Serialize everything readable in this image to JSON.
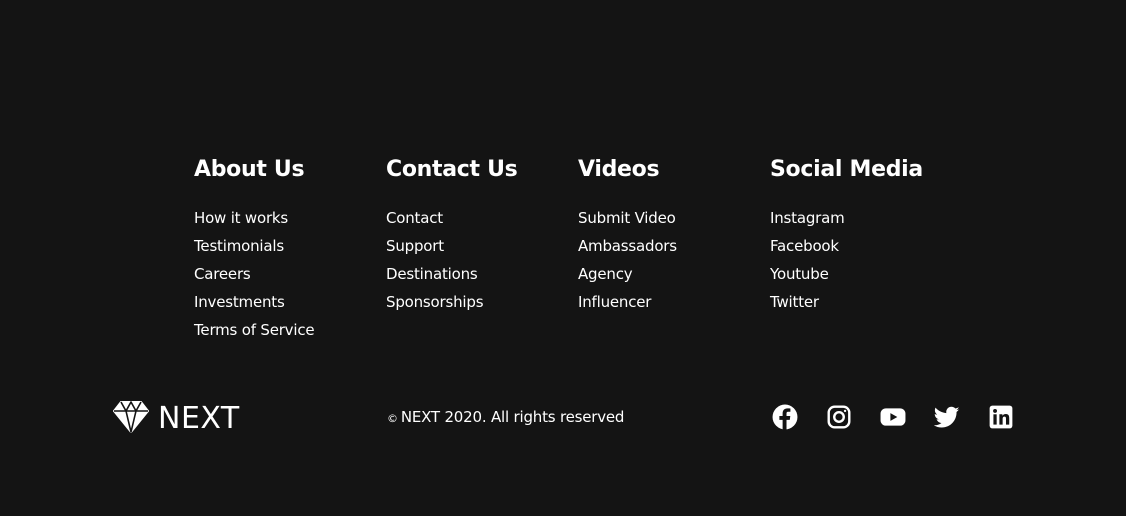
{
  "columns": [
    {
      "title": "About Us",
      "items": [
        "How it works",
        "Testimonials",
        "Careers",
        "Investments",
        "Terms of Service"
      ]
    },
    {
      "title": "Contact Us",
      "items": [
        "Contact",
        "Support",
        "Destinations",
        "Sponsorships"
      ]
    },
    {
      "title": "Videos",
      "items": [
        "Submit Video",
        "Ambassadors",
        "Agency",
        "Influencer"
      ]
    },
    {
      "title": "Social Media",
      "items": [
        "Instagram",
        "Facebook",
        "Youtube",
        "Twitter"
      ]
    }
  ],
  "brand": {
    "name": "NEXT",
    "icon": "diamond-icon"
  },
  "copyright": {
    "symbol": "©",
    "text": "NEXT 2020. All rights reserved"
  },
  "social_icons": [
    "facebook-icon",
    "instagram-icon",
    "youtube-icon",
    "twitter-icon",
    "linkedin-icon"
  ],
  "colors": {
    "background": "#141414",
    "text": "#ffffff"
  }
}
